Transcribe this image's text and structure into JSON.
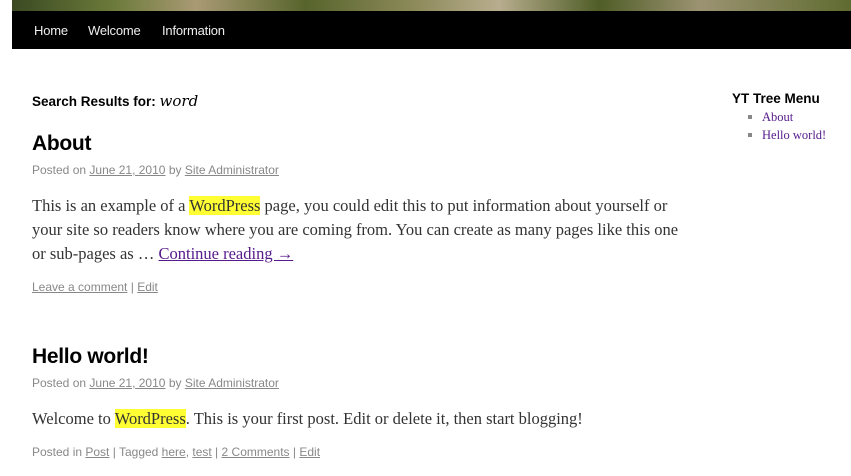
{
  "nav": {
    "items": [
      "Home",
      "Welcome",
      "Information"
    ]
  },
  "search": {
    "label": "Search Results for: ",
    "term": "word"
  },
  "posts": [
    {
      "title": "About",
      "posted_on": "Posted on",
      "date": "June 21, 2010",
      "by": "by",
      "author": "Site Administrator",
      "excerpt_before": "This is an example of a ",
      "highlight": "WordPress",
      "excerpt_after": " page, you could edit this to put information about yourself or your site so readers know where you are coming from. You can create as many pages like this one or sub-pages as … ",
      "continue_link": "Continue reading →",
      "utility": {
        "comment": "Leave a comment",
        "sep": " | ",
        "edit": "Edit"
      }
    },
    {
      "title": "Hello world!",
      "posted_on": "Posted on",
      "date": "June 21, 2010",
      "by": "by",
      "author": "Site Administrator",
      "excerpt_before": "Welcome to ",
      "highlight": "WordPress",
      "excerpt_after": ". This is your first post. Edit or delete it, then start blogging!",
      "utility": {
        "posted_in": "Posted in ",
        "category": "Post",
        "sep": " | ",
        "tagged": "Tagged ",
        "tag1": "here",
        "comma": ", ",
        "tag2": "test",
        "comments": "2 Comments",
        "edit": "Edit"
      }
    }
  ],
  "sidebar": {
    "title": "YT Tree Menu",
    "items": [
      "About",
      "Hello world!"
    ]
  }
}
